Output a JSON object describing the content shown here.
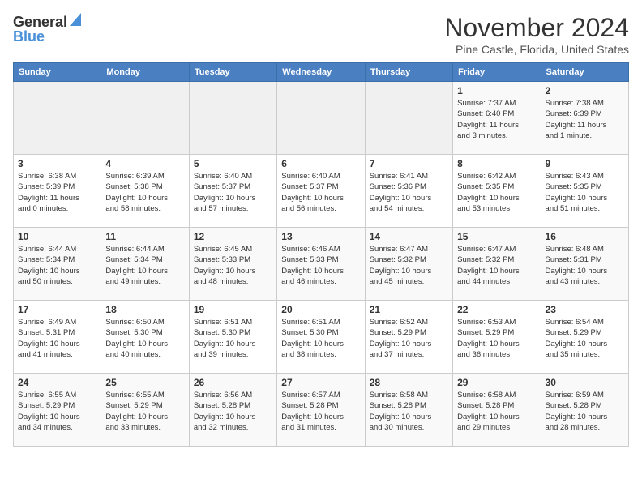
{
  "header": {
    "logo_general": "General",
    "logo_blue": "Blue",
    "title": "November 2024",
    "location": "Pine Castle, Florida, United States"
  },
  "weekdays": [
    "Sunday",
    "Monday",
    "Tuesday",
    "Wednesday",
    "Thursday",
    "Friday",
    "Saturday"
  ],
  "weeks": [
    [
      {
        "day": "",
        "info": ""
      },
      {
        "day": "",
        "info": ""
      },
      {
        "day": "",
        "info": ""
      },
      {
        "day": "",
        "info": ""
      },
      {
        "day": "",
        "info": ""
      },
      {
        "day": "1",
        "info": "Sunrise: 7:37 AM\nSunset: 6:40 PM\nDaylight: 11 hours\nand 3 minutes."
      },
      {
        "day": "2",
        "info": "Sunrise: 7:38 AM\nSunset: 6:39 PM\nDaylight: 11 hours\nand 1 minute."
      }
    ],
    [
      {
        "day": "3",
        "info": "Sunrise: 6:38 AM\nSunset: 5:39 PM\nDaylight: 11 hours\nand 0 minutes."
      },
      {
        "day": "4",
        "info": "Sunrise: 6:39 AM\nSunset: 5:38 PM\nDaylight: 10 hours\nand 58 minutes."
      },
      {
        "day": "5",
        "info": "Sunrise: 6:40 AM\nSunset: 5:37 PM\nDaylight: 10 hours\nand 57 minutes."
      },
      {
        "day": "6",
        "info": "Sunrise: 6:40 AM\nSunset: 5:37 PM\nDaylight: 10 hours\nand 56 minutes."
      },
      {
        "day": "7",
        "info": "Sunrise: 6:41 AM\nSunset: 5:36 PM\nDaylight: 10 hours\nand 54 minutes."
      },
      {
        "day": "8",
        "info": "Sunrise: 6:42 AM\nSunset: 5:35 PM\nDaylight: 10 hours\nand 53 minutes."
      },
      {
        "day": "9",
        "info": "Sunrise: 6:43 AM\nSunset: 5:35 PM\nDaylight: 10 hours\nand 51 minutes."
      }
    ],
    [
      {
        "day": "10",
        "info": "Sunrise: 6:44 AM\nSunset: 5:34 PM\nDaylight: 10 hours\nand 50 minutes."
      },
      {
        "day": "11",
        "info": "Sunrise: 6:44 AM\nSunset: 5:34 PM\nDaylight: 10 hours\nand 49 minutes."
      },
      {
        "day": "12",
        "info": "Sunrise: 6:45 AM\nSunset: 5:33 PM\nDaylight: 10 hours\nand 48 minutes."
      },
      {
        "day": "13",
        "info": "Sunrise: 6:46 AM\nSunset: 5:33 PM\nDaylight: 10 hours\nand 46 minutes."
      },
      {
        "day": "14",
        "info": "Sunrise: 6:47 AM\nSunset: 5:32 PM\nDaylight: 10 hours\nand 45 minutes."
      },
      {
        "day": "15",
        "info": "Sunrise: 6:47 AM\nSunset: 5:32 PM\nDaylight: 10 hours\nand 44 minutes."
      },
      {
        "day": "16",
        "info": "Sunrise: 6:48 AM\nSunset: 5:31 PM\nDaylight: 10 hours\nand 43 minutes."
      }
    ],
    [
      {
        "day": "17",
        "info": "Sunrise: 6:49 AM\nSunset: 5:31 PM\nDaylight: 10 hours\nand 41 minutes."
      },
      {
        "day": "18",
        "info": "Sunrise: 6:50 AM\nSunset: 5:30 PM\nDaylight: 10 hours\nand 40 minutes."
      },
      {
        "day": "19",
        "info": "Sunrise: 6:51 AM\nSunset: 5:30 PM\nDaylight: 10 hours\nand 39 minutes."
      },
      {
        "day": "20",
        "info": "Sunrise: 6:51 AM\nSunset: 5:30 PM\nDaylight: 10 hours\nand 38 minutes."
      },
      {
        "day": "21",
        "info": "Sunrise: 6:52 AM\nSunset: 5:29 PM\nDaylight: 10 hours\nand 37 minutes."
      },
      {
        "day": "22",
        "info": "Sunrise: 6:53 AM\nSunset: 5:29 PM\nDaylight: 10 hours\nand 36 minutes."
      },
      {
        "day": "23",
        "info": "Sunrise: 6:54 AM\nSunset: 5:29 PM\nDaylight: 10 hours\nand 35 minutes."
      }
    ],
    [
      {
        "day": "24",
        "info": "Sunrise: 6:55 AM\nSunset: 5:29 PM\nDaylight: 10 hours\nand 34 minutes."
      },
      {
        "day": "25",
        "info": "Sunrise: 6:55 AM\nSunset: 5:29 PM\nDaylight: 10 hours\nand 33 minutes."
      },
      {
        "day": "26",
        "info": "Sunrise: 6:56 AM\nSunset: 5:28 PM\nDaylight: 10 hours\nand 32 minutes."
      },
      {
        "day": "27",
        "info": "Sunrise: 6:57 AM\nSunset: 5:28 PM\nDaylight: 10 hours\nand 31 minutes."
      },
      {
        "day": "28",
        "info": "Sunrise: 6:58 AM\nSunset: 5:28 PM\nDaylight: 10 hours\nand 30 minutes."
      },
      {
        "day": "29",
        "info": "Sunrise: 6:58 AM\nSunset: 5:28 PM\nDaylight: 10 hours\nand 29 minutes."
      },
      {
        "day": "30",
        "info": "Sunrise: 6:59 AM\nSunset: 5:28 PM\nDaylight: 10 hours\nand 28 minutes."
      }
    ]
  ]
}
